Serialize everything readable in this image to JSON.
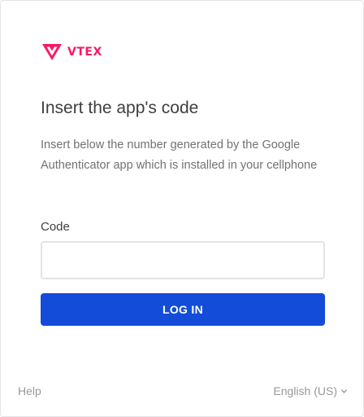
{
  "brand": {
    "name": "VTEX",
    "logo_icon": "vtex-logo-icon",
    "color": "#f71963"
  },
  "page": {
    "title": "Insert the app's code",
    "description": "Insert below the number generated by the Google Authenticator app which is installed in your cellphone"
  },
  "form": {
    "code_label": "Code",
    "code_value": "",
    "code_placeholder": "",
    "submit_label": "LOG IN",
    "submit_color": "#134cd8"
  },
  "footer": {
    "help_label": "Help",
    "language_label": "English (US)",
    "language_icon": "chevron-down-icon"
  }
}
